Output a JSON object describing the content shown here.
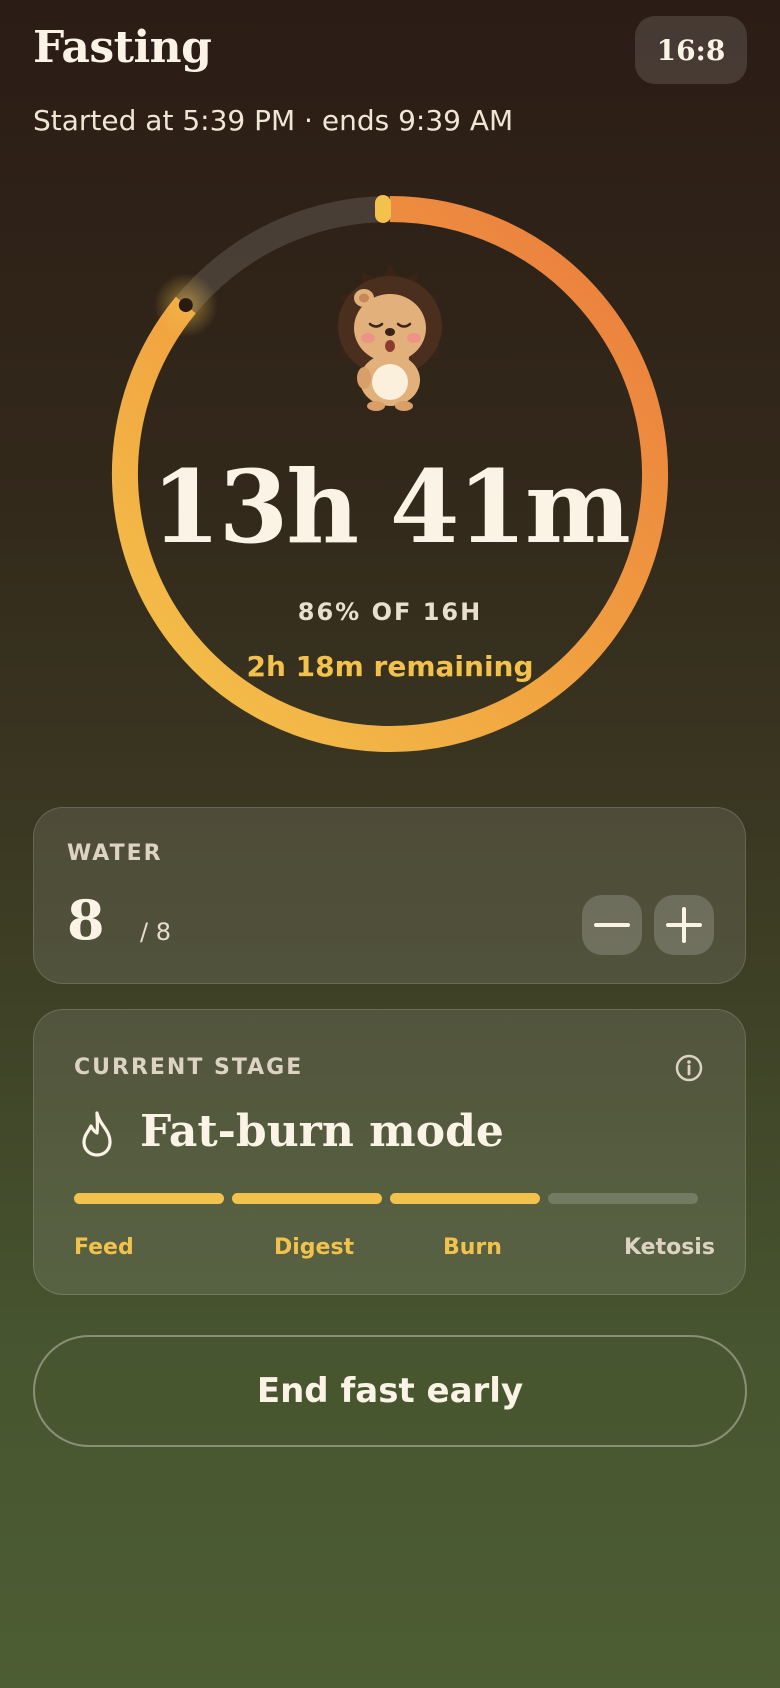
{
  "header": {
    "title": "Fasting",
    "plan_badge": "16:8"
  },
  "subtitle": "Started at 5:39 PM · ends 9:39 AM",
  "timer": {
    "elapsed": "13h 41m",
    "percent_label": "86% OF 16H",
    "remaining": "2h 18m remaining",
    "progress_fraction": 0.86
  },
  "water": {
    "label": "WATER",
    "value": "8",
    "total": "/ 8"
  },
  "stage": {
    "label": "CURRENT STAGE",
    "name": "Fat-burn mode",
    "steps": [
      {
        "label": "Feed",
        "active": true
      },
      {
        "label": "Digest",
        "active": true
      },
      {
        "label": "Burn",
        "active": true
      },
      {
        "label": "Ketosis",
        "active": false
      }
    ]
  },
  "actions": {
    "end_fast": "End fast early"
  },
  "colors": {
    "accent_yellow": "#f3c24c",
    "accent_orange": "#ea7a3e",
    "text_light": "#fbf3e6"
  },
  "icons": {
    "mascot": "sleepy-hedgehog-icon",
    "minus": "minus-icon",
    "plus": "plus-icon",
    "info": "info-icon",
    "flame": "flame-icon"
  }
}
